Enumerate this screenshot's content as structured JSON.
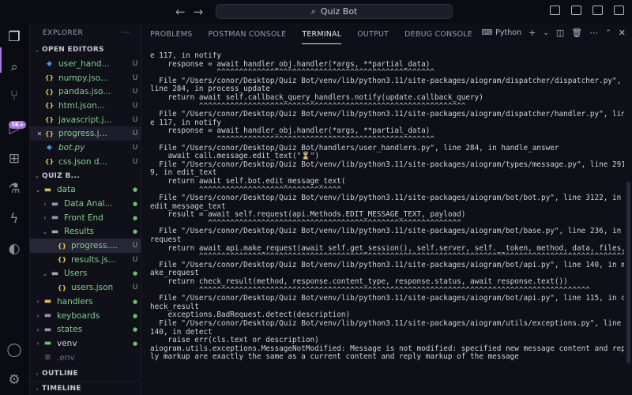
{
  "titlebar": {
    "search_text": "Quiz Bot"
  },
  "activity_bar": {
    "badge": "2K+",
    "accent": "#a974e8"
  },
  "explorer": {
    "title": "EXPLORER",
    "more": "···",
    "open_editors": {
      "title": "OPEN EDITORS",
      "items": [
        {
          "name": "user_hand...",
          "status": "U",
          "icon": "python-icon"
        },
        {
          "name": "numpy.jso...",
          "status": "U",
          "icon": "json-icon"
        },
        {
          "name": "pandas.jso...",
          "status": "U",
          "icon": "json-icon"
        },
        {
          "name": "html.json...",
          "status": "U",
          "icon": "json-icon"
        },
        {
          "name": "javascript.j...",
          "status": "U",
          "icon": "json-icon"
        },
        {
          "name": "progress.j...",
          "status": "U",
          "icon": "json-icon",
          "close": "✕"
        },
        {
          "name": "bot.py",
          "status": "U",
          "icon": "python-icon"
        },
        {
          "name": "css.json d...",
          "status": "U",
          "icon": "json-icon"
        }
      ]
    },
    "workspace": {
      "title": "QUIZ B...",
      "tree": [
        {
          "name": "data",
          "depth": 1,
          "type": "folder-open"
        },
        {
          "name": "Data Anal...",
          "depth": 2,
          "type": "folder"
        },
        {
          "name": "Front End",
          "depth": 2,
          "type": "folder"
        },
        {
          "name": "Results",
          "depth": 2,
          "type": "folder-open"
        },
        {
          "name": "progress....",
          "depth": 3,
          "type": "json",
          "status": "U"
        },
        {
          "name": "results.js...",
          "depth": 3,
          "type": "json",
          "status": "U"
        },
        {
          "name": "Users",
          "depth": 2,
          "type": "folder-open"
        },
        {
          "name": "users.json",
          "depth": 3,
          "type": "json",
          "status": "U"
        },
        {
          "name": "handlers",
          "depth": 1,
          "type": "folder"
        },
        {
          "name": "keyboards",
          "depth": 1,
          "type": "folder"
        },
        {
          "name": "states",
          "depth": 1,
          "type": "folder"
        },
        {
          "name": "venv",
          "depth": 1,
          "type": "folder"
        },
        {
          "name": ".env",
          "depth": 1,
          "type": "file"
        }
      ]
    },
    "outline": "OUTLINE",
    "timeline": "TIMELINE"
  },
  "panel": {
    "tabs": [
      "PROBLEMS",
      "POSTMAN CONSOLE",
      "TERMINAL",
      "OUTPUT",
      "DEBUG CONSOLE"
    ],
    "active_tab": "TERMINAL",
    "shell": "Python",
    "terminal_lines": [
      "e 117, in notify",
      "    response = await handler_obj.handler(*args, **partial_data)",
      "               ^^^^^^^^^^^^^^^^^^^^^^^^^^^^^^^^^^^^^^^^^^^^^^^^^",
      "  File \"/Users/conor/Desktop/Quiz Bot/venv/lib/python3.11/site-packages/aiogram/dispatcher/dispatcher.py\",",
      "line 284, in process_update",
      "    return await self.callback_query_handlers.notify(update.callback_query)",
      "           ^^^^^^^^^^^^^^^^^^^^^^^^^^^^^^^^^^^^^^^^^^^^^^^^^^^^^^^^^^^^",
      "  File \"/Users/conor/Desktop/Quiz Bot/venv/lib/python3.11/site-packages/aiogram/dispatcher/handler.py\", lin",
      "e 117, in notify",
      "    response = await handler_obj.handler(*args, **partial_data)",
      "               ^^^^^^^^^^^^^^^^^^^^^^^^^^^^^^^^^^^^^^^^^^^^^^^^^",
      "  File \"/Users/conor/Desktop/Quiz Bot/handlers/user_handlers.py\", line 284, in handle_answer",
      "    await call.message.edit_text(\"⏳\")",
      "  File \"/Users/conor/Desktop/Quiz Bot/venv/lib/python3.11/site-packages/aiogram/types/message.py\", line 291",
      "9, in edit_text",
      "    return await self.bot.edit_message_text(",
      "           ^^^^^^^^^^^^^^^^^^^^^^^^^^^^^^^^",
      "  File \"/Users/conor/Desktop/Quiz Bot/venv/lib/python3.11/site-packages/aiogram/bot/bot.py\", line 3122, in",
      "edit_message_text",
      "    result = await self.request(api.Methods.EDIT_MESSAGE_TEXT, payload)",
      "             ^^^^^^^^^^^^^^^^^^^^^^^^^^^^^^^^^^^^^^^^^^^^^^^^^^^^^^^^^",
      "  File \"/Users/conor/Desktop/Quiz Bot/venv/lib/python3.11/site-packages/aiogram/bot/base.py\", line 236, in",
      "request",
      "    return await api.make_request(await self.get_session(), self.server, self.__token, method, data, files,",
      "           ^^^^^^^^^^^^^^^^^^^^^^^^^^^^^^^^^^^^^^^^^^^^^^^^^^^^^^^^^^^^^^^^^^^^^^^^^^^^^^^^^^^^^^^^^^^^^^^^",
      "  File \"/Users/conor/Desktop/Quiz Bot/venv/lib/python3.11/site-packages/aiogram/bot/api.py\", line 140, in m",
      "ake_request",
      "    return check_result(method, response.content_type, response.status, await response.text())",
      "           ^^^^^^^^^^^^^^^^^^^^^^^^^^^^^^^^^^^^^^^^^^^^^^^^^^^^^^^^^^^^^^^^^^^^^^^^^^^^^^^^^^^^^^^^",
      "  File \"/Users/conor/Desktop/Quiz Bot/venv/lib/python3.11/site-packages/aiogram/bot/api.py\", line 115, in c",
      "heck_result",
      "    exceptions.BadRequest.detect(description)",
      "  File \"/Users/conor/Desktop/Quiz Bot/venv/lib/python3.11/site-packages/aiogram/utils/exceptions.py\", line",
      "140, in detect",
      "    raise err(cls.text or description)",
      "aiogram.utils.exceptions.MessageNotModified: Message is not modified: specified new message content and rep",
      "ly markup are exactly the same as a current content and reply markup of the message"
    ]
  }
}
